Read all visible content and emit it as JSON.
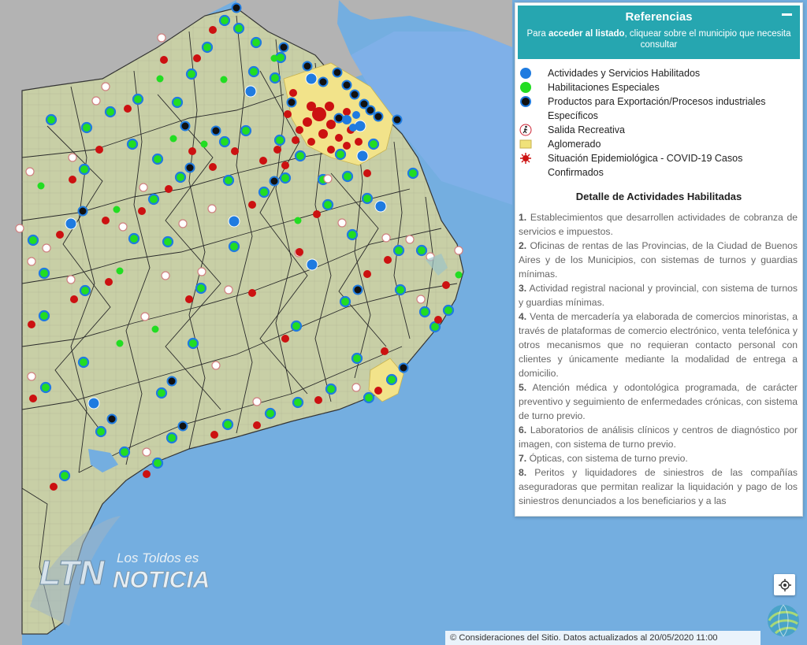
{
  "panel": {
    "title": "Referencias",
    "subtitle_prefix": "Para ",
    "subtitle_bold": "acceder al listado",
    "subtitle_suffix": ", cliquear sobre el municipio que necesita consultar"
  },
  "legend": [
    {
      "label": "Actividades y Servicios Habilitados",
      "icon": "blue-dot",
      "color": "#1f7be0"
    },
    {
      "label": "Habilitaciones Especiales",
      "icon": "green-dot",
      "color": "#22dd22"
    },
    {
      "label": "Productos para Exportación/Procesos industriales Específicos",
      "icon": "black-dot",
      "color": "#111111"
    },
    {
      "label": "Salida Recreativa",
      "icon": "walker-icon",
      "color": "#cc2233"
    },
    {
      "label": "Aglomerado",
      "icon": "yellow-area",
      "color": "#f0e27a"
    },
    {
      "label": "Situación Epidemiológica - COVID-19 Casos Confirmados",
      "icon": "virus-icon",
      "color": "#cc1111"
    }
  ],
  "details": {
    "title": "Detalle de Actividades Habilitadas",
    "items": [
      {
        "num": "1.",
        "text": "Establecimientos que desarrollen actividades de cobranza de servicios e impuestos."
      },
      {
        "num": "2.",
        "text": "Oficinas de rentas de las Provincias, de la Ciudad de Buenos Aires y de los Municipios, con sistemas de turnos y guardias mínimas."
      },
      {
        "num": "3.",
        "text": "Actividad registral nacional y provincial, con sistema de turnos y guardias mínimas."
      },
      {
        "num": "4.",
        "text": "Venta de mercadería ya elaborada de comercios minoristas, a través de plataformas de comercio electrónico, venta telefónica y otros mecanismos que no requieran contacto personal con clientes y únicamente mediante la modalidad de entrega a domicilio."
      },
      {
        "num": "5.",
        "text": "Atención médica y odontológica programada, de carácter preventivo y seguimiento de enfermedades crónicas, con sistema de turno previo."
      },
      {
        "num": "6.",
        "text": "Laboratorios de análisis clínicos y centros de diagnóstico por imagen, con sistema de turno previo."
      },
      {
        "num": "7.",
        "text": "Ópticas, con sistema de turno previo."
      },
      {
        "num": "8.",
        "text": "Peritos y liquidadores de siniestros de las compañías aseguradoras que permitan realizar la liquidación y pago de los siniestros denunciados a los beneficiarios y a las"
      }
    ]
  },
  "attribution": "© Consideraciones del Sitio. Datos actualizados al 20/05/2020 11:00",
  "watermark": {
    "mark": "LTN",
    "line1": "Los Toldos es",
    "line2": "NOTICIA"
  },
  "colors": {
    "sea": "#74aee0",
    "land": "#c8cfa6",
    "neighbor": "#b0b0b0",
    "river": "#7fb0e8"
  }
}
